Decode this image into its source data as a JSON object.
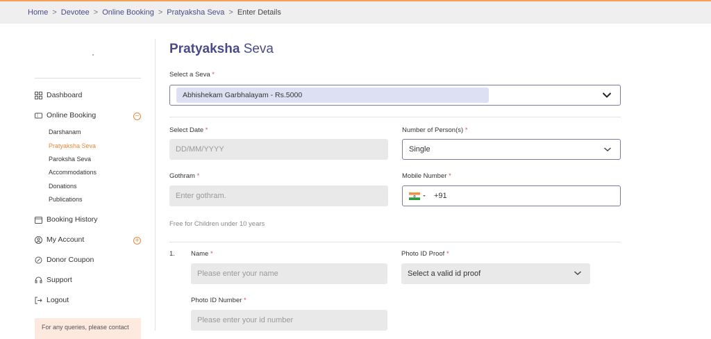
{
  "breadcrumb": {
    "items": [
      "Home",
      "Devotee",
      "Online Booking",
      "Pratyaksha Seva"
    ],
    "current": "Enter Details",
    "separator": ">"
  },
  "sidebar": {
    "items": [
      {
        "label": "Dashboard",
        "icon": "grid-icon"
      },
      {
        "label": "Online Booking",
        "icon": "ticket-icon",
        "toggle": "−"
      },
      {
        "label": "Booking History",
        "icon": "calendar-icon"
      },
      {
        "label": "My Account",
        "icon": "user-circle-icon",
        "toggle": "+"
      },
      {
        "label": "Donor Coupon",
        "icon": "coupon-icon"
      },
      {
        "label": "Support",
        "icon": "support-icon"
      },
      {
        "label": "Logout",
        "icon": "logout-icon"
      }
    ],
    "sub_items": [
      "Darshanam",
      "Pratyaksha Seva",
      "Paroksha Seva",
      "Accommodations",
      "Donations",
      "Publications"
    ],
    "active_sub": "Pratyaksha Seva",
    "help_text": "For any queries, please contact"
  },
  "page": {
    "title_bold": "Pratyaksha",
    "title_light": "Seva"
  },
  "form": {
    "seva_label": "Select a Seva",
    "seva_value": "Abhishekam Garbhalayam  - Rs.5000",
    "date_label": "Select Date",
    "date_placeholder": "DD/MM/YYYY",
    "persons_label": "Number of Person(s)",
    "persons_value": "Single",
    "gothram_label": "Gothram",
    "gothram_placeholder": "Enter gothram.",
    "mobile_label": "Mobile Number",
    "mobile_code": "+91",
    "children_note": "Free for Children under 10 years",
    "person_index": "1.",
    "name_label": "Name",
    "name_placeholder": "Please enter your name",
    "id_proof_label": "Photo ID Proof",
    "id_proof_placeholder": "Select a valid id proof",
    "id_number_label": "Photo ID Number",
    "id_number_placeholder": "Please enter your id number",
    "required_mark": "*"
  },
  "colors": {
    "accent": "#e8893a",
    "brand": "#4a4a8a",
    "chip": "#dde0f3",
    "field_grey": "#e9e9e9"
  }
}
